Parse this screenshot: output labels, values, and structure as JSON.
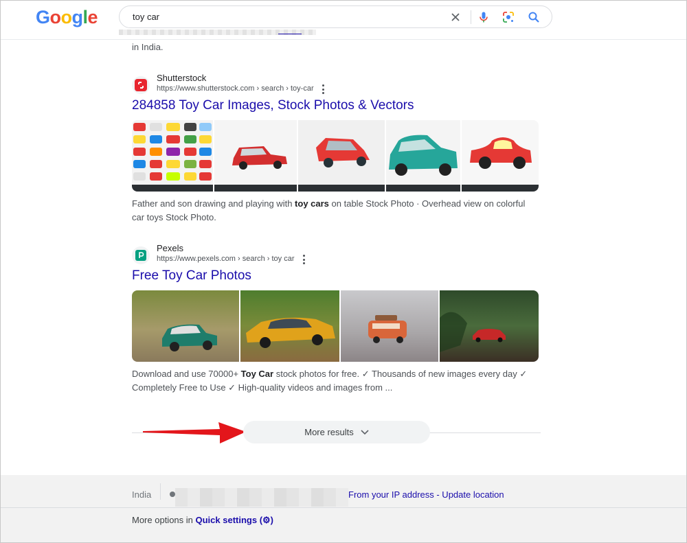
{
  "header": {
    "logo": [
      "G",
      "o",
      "o",
      "g",
      "l",
      "e"
    ],
    "logo_colors": [
      "#4285F4",
      "#EA4335",
      "#FBBC05",
      "#4285F4",
      "#34A853",
      "#EA4335"
    ],
    "search_value": "toy car"
  },
  "prev_result": {
    "snippet_tail": "in India."
  },
  "results": [
    {
      "site_name": "Shutterstock",
      "url": "https://www.shutterstock.com › search › toy-car",
      "title": "284858 Toy Car Images, Stock Photos & Vectors",
      "snippet_pre": "Father and son drawing and playing with ",
      "snippet_bold": "toy cars",
      "snippet_post": " on table Stock Photo · Overhead view on colorful car toys Stock Photo."
    },
    {
      "site_name": "Pexels",
      "url": "https://www.pexels.com › search › toy car",
      "title": "Free Toy Car Photos",
      "snippet_pre": "Download and use 70000+ ",
      "snippet_bold": "Toy Car",
      "snippet_post": " stock photos for free. ✓ Thousands of new images every day ✓ Completely Free to Use ✓ High-quality videos and images from ..."
    }
  ],
  "more_results": "More results",
  "footer": {
    "country": "India",
    "location_link": "From your IP address - Update location",
    "options_pre": "More options in ",
    "options_link": "Quick settings (⚙)"
  },
  "colors": {
    "link": "#1a0dab",
    "arrow": "#e3161b",
    "shutterstock": "#e8262f",
    "pexels": "#05a081"
  }
}
